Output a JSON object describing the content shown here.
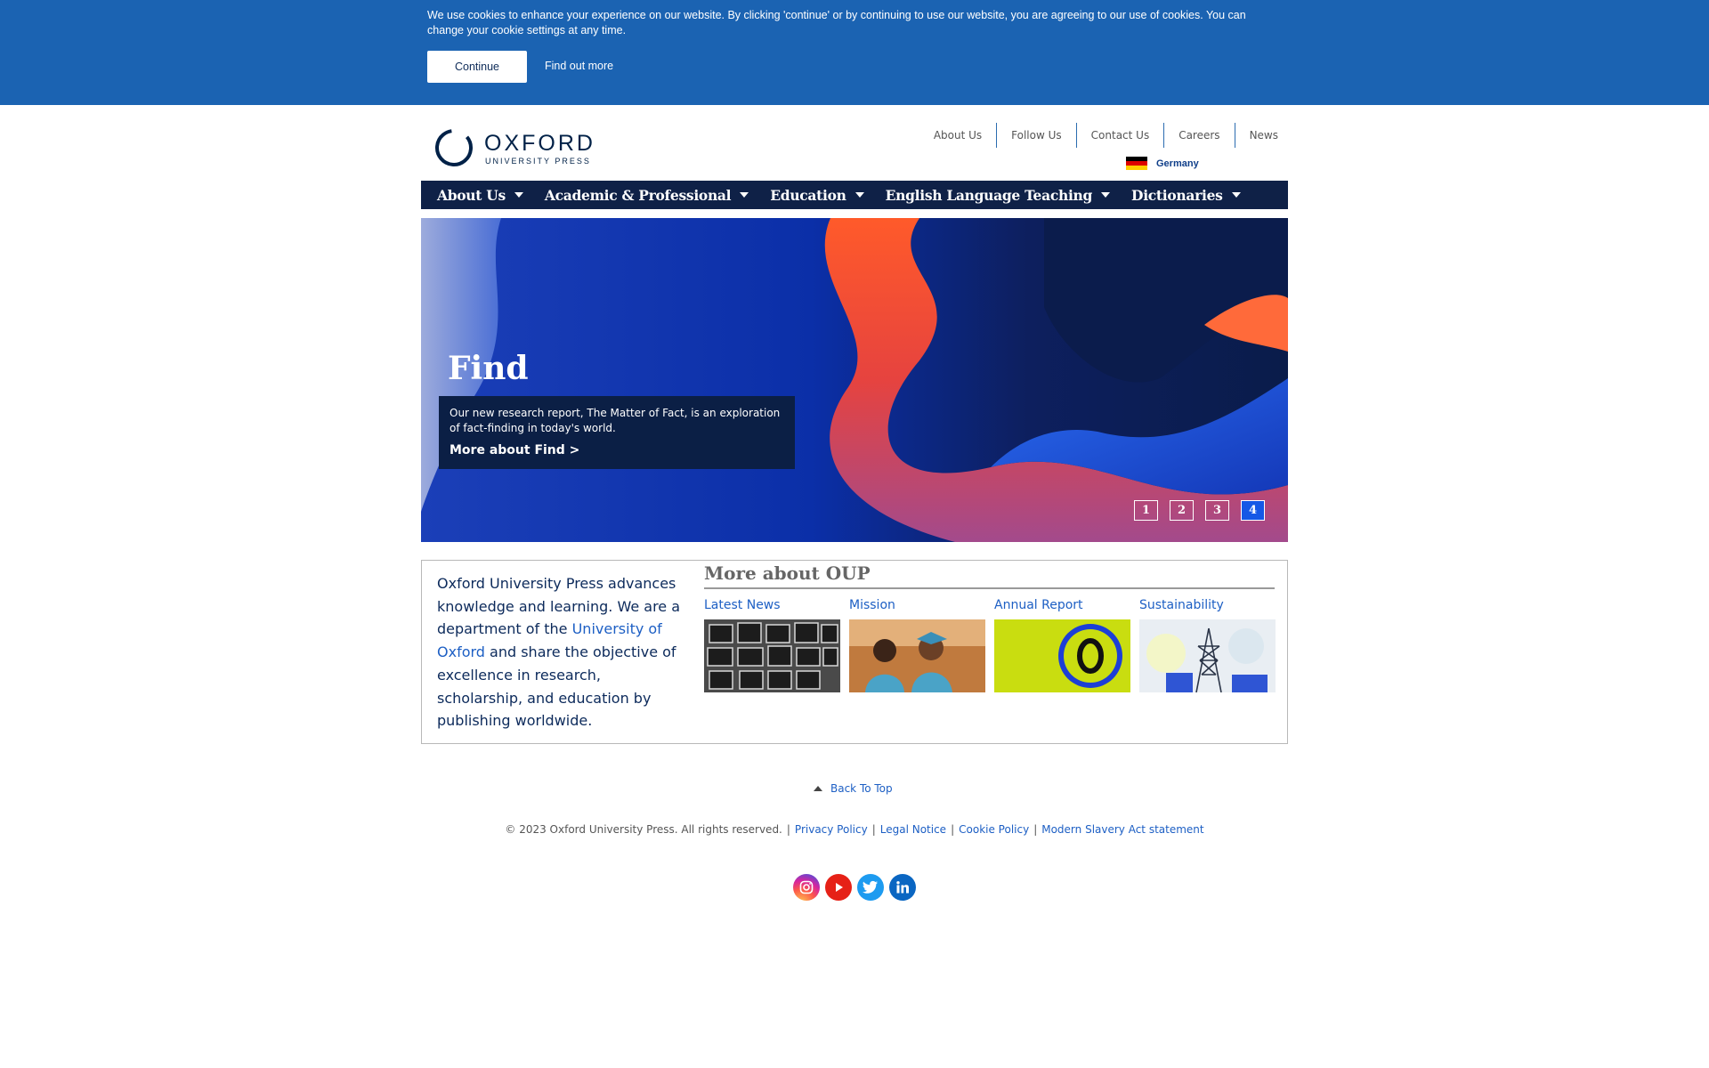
{
  "cookie": {
    "message": "We use cookies to enhance your experience on our website. By clicking 'continue' or by continuing to use our website, you are agreeing to our use of cookies. You can change your cookie settings at any time.",
    "continue_label": "Continue",
    "find_out_more": "Find out more"
  },
  "header": {
    "logo_name": "OXFORD",
    "logo_sub": "UNIVERSITY PRESS",
    "top_links": [
      "About Us",
      "Follow Us",
      "Contact Us",
      "Careers",
      "News"
    ],
    "country": "Germany"
  },
  "nav": {
    "items": [
      "About Us",
      "Academic & Professional",
      "Education",
      "English Language Teaching",
      "Dictionaries"
    ]
  },
  "hero": {
    "title": "Find",
    "description": "Our new research report, The Matter of Fact, is an exploration of fact-finding in today's world.",
    "link": "More about Find >",
    "pages": [
      "1",
      "2",
      "3",
      "4"
    ],
    "active_page": "4"
  },
  "info": {
    "intro_before": "Oxford University Press advances knowledge and learning. We are a department of the ",
    "intro_link": "University of Oxford",
    "intro_after": " and share the objective of excellence in research, scholarship, and education by publishing worldwide.",
    "more_title": "More about OUP",
    "cards": [
      "Latest News",
      "Mission",
      "Annual Report",
      "Sustainability"
    ]
  },
  "footer": {
    "back_to_top": "Back To Top",
    "copyright": "© 2023 Oxford University Press. All rights reserved.",
    "links": [
      "Privacy Policy",
      "Legal Notice",
      "Cookie Policy",
      "Modern Slavery Act statement"
    ],
    "social": [
      "instagram-icon",
      "youtube-icon",
      "twitter-icon",
      "linkedin-icon"
    ]
  },
  "colors": {
    "banner": "#1b63b2",
    "nav": "#0f2147",
    "link": "#1d5fc4",
    "active_page": "#1558e6"
  }
}
